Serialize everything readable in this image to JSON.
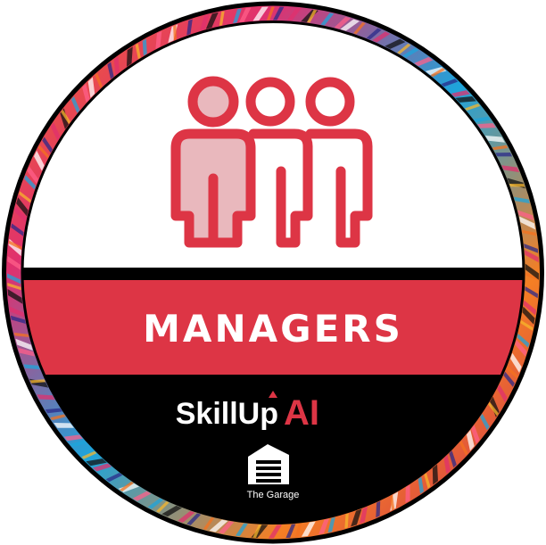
{
  "badge": {
    "title": "MANAGERS",
    "brand_skill": "SkillUp",
    "brand_ai": "AI",
    "org_name": "The Garage",
    "icon": "people-group-icon",
    "colors": {
      "accent_red": "#dd3545",
      "panel_black": "#000000",
      "icon_fill_light": "#e9b8bd",
      "ring_orange": "#f4711f",
      "ring_blue": "#1da4db",
      "ring_pink": "#e0306e"
    }
  }
}
